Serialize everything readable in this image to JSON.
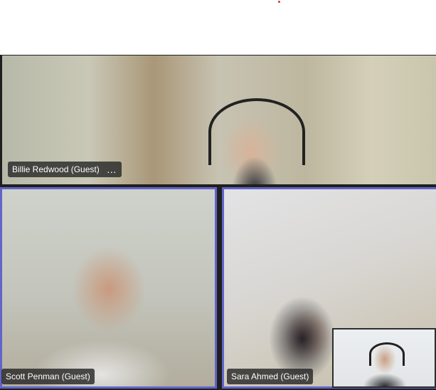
{
  "participants": [
    {
      "name": "Billie Redwood (Guest)",
      "role": "active-speaker",
      "more_options_icon": "more-icon"
    },
    {
      "name": "Scott Penman (Guest)",
      "role": "video-tile"
    },
    {
      "name": "Sara Ahmed (Guest)",
      "role": "video-tile"
    }
  ],
  "colors": {
    "tile_border": "#6264c8",
    "name_tag_bg": "#282828",
    "recording_dot": "#c43b3b",
    "stage_bg": "#1f1f1f"
  },
  "icons": {
    "more_options": "…",
    "recording_indicator": "dot"
  }
}
